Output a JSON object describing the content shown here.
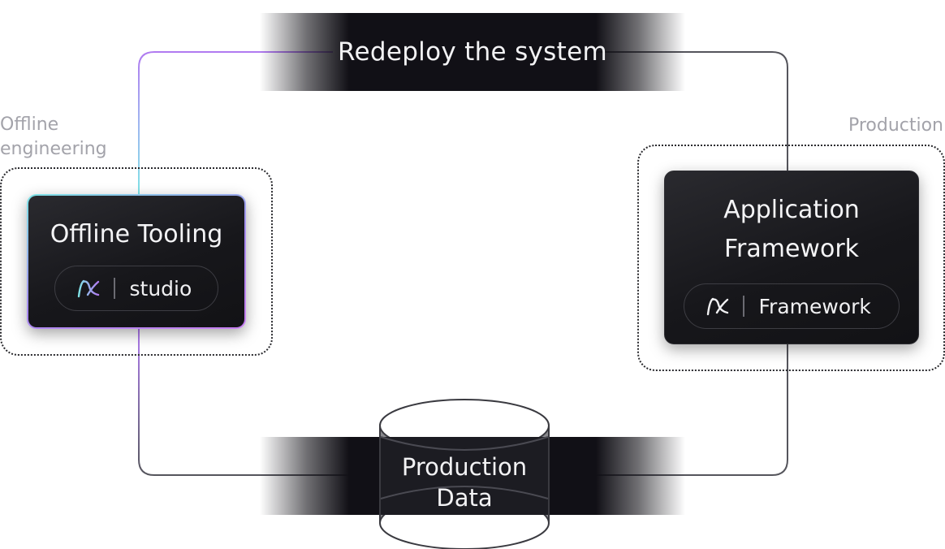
{
  "loop": {
    "top_label": "Redeploy the system",
    "bottom_label": "Production\nData"
  },
  "zones": {
    "offline_label": "Offline\nengineering",
    "production_label": "Production"
  },
  "cards": {
    "offline": {
      "title": "Offline Tooling",
      "pill_label": "studio",
      "pill_icon": "logo-icon"
    },
    "app": {
      "title": "Application Framework",
      "pill_label": "Framework",
      "pill_icon": "logo-icon"
    }
  },
  "colors": {
    "band": "#111016",
    "card": "#17171b",
    "loop_line": "#55555c",
    "accent_purple": "#b07af0",
    "accent_cyan": "#7fe3e6",
    "zone_text": "#a3a3aa"
  }
}
